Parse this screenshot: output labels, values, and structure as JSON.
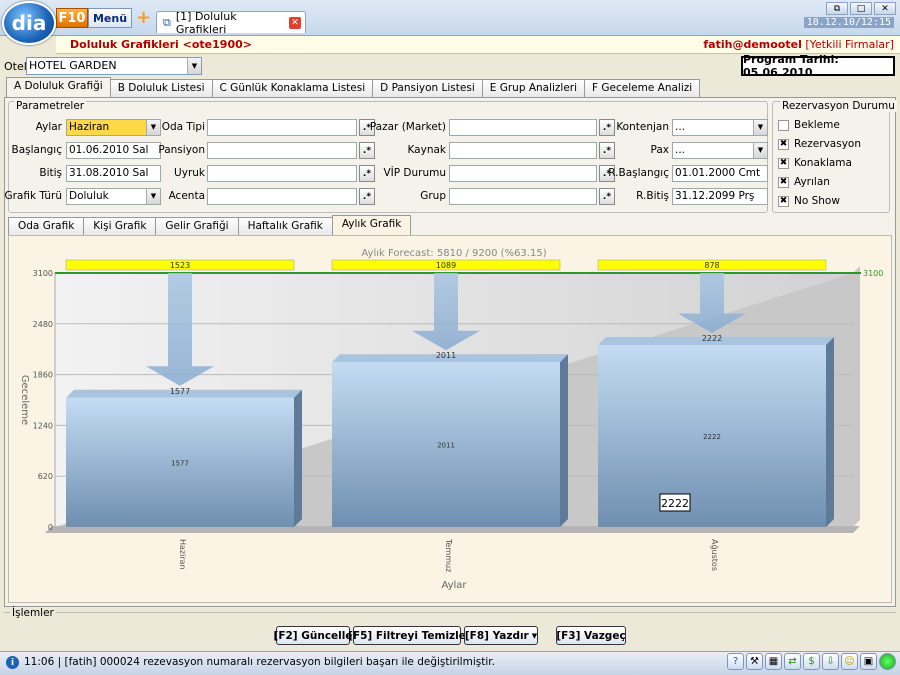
{
  "app": {
    "logo": "dia",
    "f10": "F10",
    "menu": "Menü",
    "tab_title": "[1] Doluluk Grafikleri",
    "clock": "18.12.10/12:15"
  },
  "header": {
    "title": "Doluluk Grafikleri <ote1900>",
    "user": "fatih@demootel",
    "firms": "[Yetkili Firmalar]"
  },
  "otel": {
    "label": "Otel",
    "value": "HOTEL GARDEN"
  },
  "program_date": "Program Tarihi: 05.06.2010",
  "main_tabs": [
    "A Doluluk Grafiği",
    "B Doluluk Listesi",
    "C Günlük Konaklama Listesi",
    "D Pansiyon Listesi",
    "E Grup Analizleri",
    "F Geceleme Analizi"
  ],
  "params": {
    "group_label": "Parametreler",
    "aylar_label": "Aylar",
    "aylar_value": "Haziran",
    "baslangic_label": "Başlangıç",
    "baslangic_value": "01.06.2010 Sal",
    "bitis_label": "Bitiş",
    "bitis_value": "31.08.2010 Sal",
    "grafik_turu_label": "Grafik Türü",
    "grafik_turu_value": "Doluluk",
    "oda_tipi_label": "Oda Tipi",
    "pansiyon_label": "Pansiyon",
    "uyruk_label": "Uyruk",
    "acenta_label": "Acenta",
    "pazar_label": "Pazar (Market)",
    "kaynak_label": "Kaynak",
    "vip_label": "VİP Durumu",
    "grup_label": "Grup",
    "kontenjan_label": "Kontenjan",
    "kontenjan_value": "...",
    "pax_label": "Pax",
    "pax_value": "...",
    "rbaslangic_label": "R.Başlangıç",
    "rbaslangic_value": "01.01.2000 Cmt",
    "rbitis_label": "R.Bitiş",
    "rbitis_value": "31.12.2099 Prş",
    "dot_btn": ".*"
  },
  "rez_durumu": {
    "label": "Rezervasyon Durumu",
    "items": [
      {
        "label": "Bekleme",
        "checked": ""
      },
      {
        "label": "Rezervasyon",
        "checked": "✖"
      },
      {
        "label": "Konaklama",
        "checked": "✖"
      },
      {
        "label": "Ayrılan",
        "checked": "✖"
      },
      {
        "label": "No Show",
        "checked": "✖"
      }
    ]
  },
  "chart_tabs": [
    "Oda Grafik",
    "Kişi Grafik",
    "Gelir Grafiği",
    "Haftalık Grafik",
    "Aylık Grafik"
  ],
  "chart_data": {
    "type": "bar",
    "title": "Aylık Forecast: 5810 / 9200 (%63.15)",
    "xlabel": "Aylar",
    "ylabel": "Geceleme",
    "categories": [
      "Haziran",
      "Temmuz",
      "Ağustos"
    ],
    "values": [
      1577,
      2011,
      2222
    ],
    "remaining": [
      1523,
      1089,
      878
    ],
    "capacity_line": 3100,
    "yticks": [
      0,
      620,
      1240,
      1860,
      2480,
      3100
    ],
    "ylim": [
      0,
      3100
    ],
    "tooltip": "2222",
    "colors": {
      "bar": "#8fb3d6",
      "remaining": "#ffff00",
      "capacity": "#2a9a2a"
    }
  },
  "islemler": {
    "label": "İşlemler",
    "guncelle": "[F2] Güncelle",
    "filtre": "[F5] Filtreyi Temizle",
    "yazdir": "[F8] Yazdır",
    "vazgec": "[F3] Vazgeç"
  },
  "status": {
    "text": "11:06 | [fatih] 000024 rezevasyon numaralı rezervasyon bilgileri başarı ile değiştirilmiştir."
  }
}
